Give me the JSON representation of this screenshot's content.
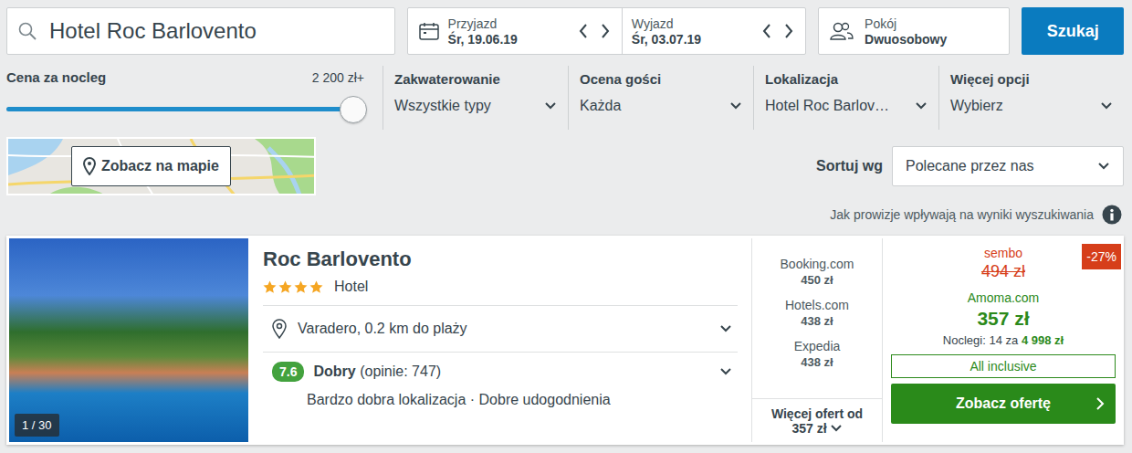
{
  "search": {
    "value": "Hotel Roc Barlovento"
  },
  "dates": [
    {
      "label": "Przyjazd",
      "value": "Śr, 19.06.19"
    },
    {
      "label": "Wyjazd",
      "value": "Śr, 03.07.19"
    }
  ],
  "room": {
    "label": "Pokój",
    "value": "Dwuosobowy"
  },
  "search_button": "Szukaj",
  "filters": {
    "price": {
      "label": "Cena za nocleg",
      "reading": "2 200 zł+",
      "level": 1
    },
    "dropdowns": [
      {
        "label": "Zakwaterowanie",
        "value": "Wszystkie typy"
      },
      {
        "label": "Ocena gości",
        "value": "Każda"
      },
      {
        "label": "Lokalizacja",
        "value": "Hotel Roc Barlov…"
      },
      {
        "label": "Więcej opcji",
        "value": "Wybierz"
      }
    ]
  },
  "map_button": "Zobacz na mapie",
  "sort": {
    "label": "Sortuj wg",
    "value": "Polecane przez nas"
  },
  "commission_note": "Jak prowizje wpływają na wyniki wyszukiwania",
  "hotel": {
    "name": "Roc Barlovento",
    "stars": 4,
    "type": "Hotel",
    "photo_counter": "1 / 30",
    "location": "Varadero, 0.2 km do plaży",
    "rating": {
      "score": "7.6",
      "label": "Dobry",
      "reviews": "(opinie: 747)"
    },
    "highlights": "Bardzo dobra lokalizacja · Dobre udogodnienia",
    "offers": [
      {
        "site": "Booking.com",
        "price": "450 zł"
      },
      {
        "site": "Hotels.com",
        "price": "438 zł"
      },
      {
        "site": "Expedia",
        "price": "438 zł"
      }
    ],
    "more_offers": {
      "label": "Więcej ofert od",
      "price": "357 zł"
    },
    "deal": {
      "old_site": "sembo",
      "old_price": "494 zł",
      "discount": "-27%",
      "site": "Amoma.com",
      "price": "357 zł",
      "nights": "Noclegi: 14 za",
      "total": "4 998 zł",
      "board": "All inclusive",
      "button": "Zobacz ofertę"
    }
  }
}
